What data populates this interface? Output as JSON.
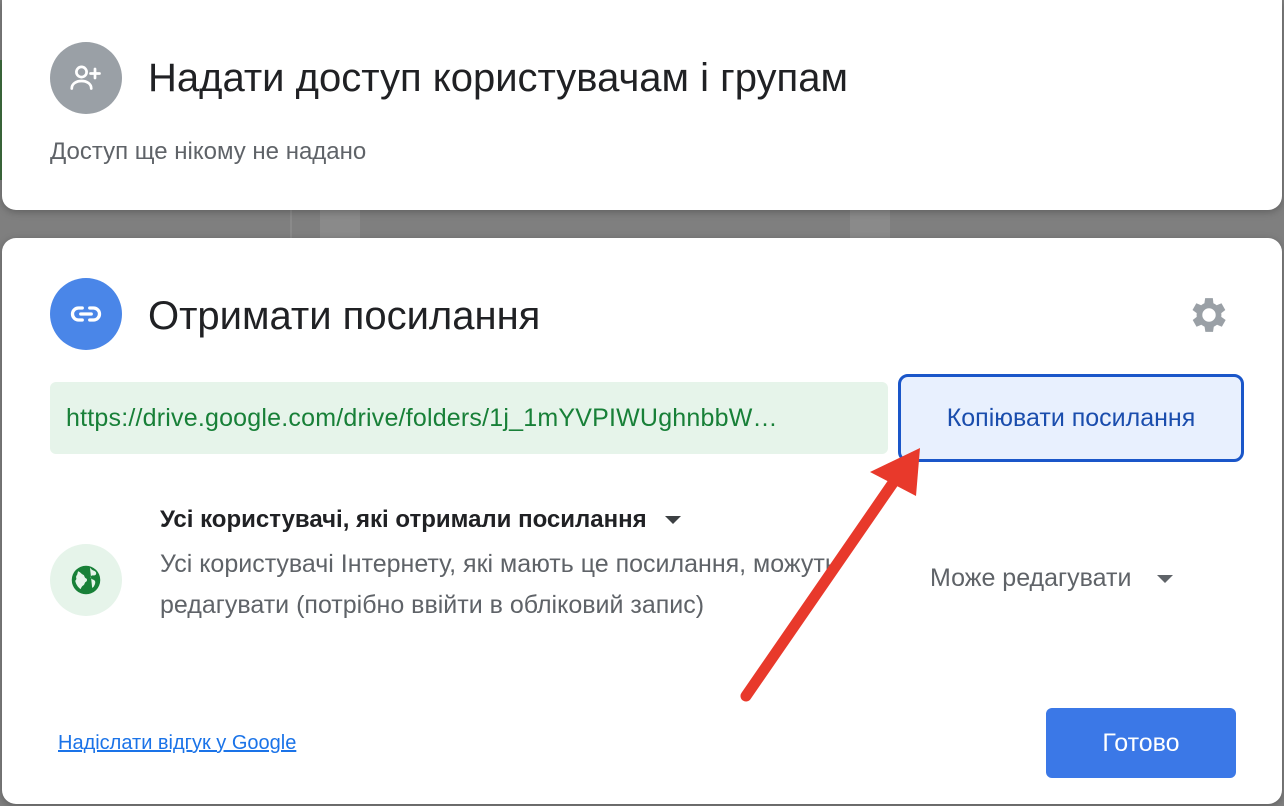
{
  "share_card": {
    "title": "Надати доступ користувачам і групам",
    "subtitle": "Доступ ще нікому не надано",
    "icon": "person-add-icon"
  },
  "link_card": {
    "title": "Отримати посилання",
    "icon": "link-icon",
    "settings_icon": "gear-icon",
    "link_url": "https://drive.google.com/drive/folders/1j_1mYVPIWUghnbbW…",
    "copy_button_label": "Копіювати посилання",
    "access": {
      "selected": "Усі користувачі, які отримали посилання",
      "description": "Усі користувачі Інтернету, які мають це посилання, можуть редагувати (потрібно ввійти в обліковий запис)",
      "icon": "globe-icon"
    },
    "role": {
      "selected": "Може редагувати"
    },
    "feedback_link": "Надіслати відгук у Google",
    "done_button_label": "Готово"
  },
  "annotation": {
    "type": "arrow",
    "color": "#e8392b",
    "points_to": "copy-button"
  },
  "colors": {
    "accent_blue": "#3b78e7",
    "link_green": "#188038",
    "link_field_bg": "#e6f4ea",
    "copy_button_border": "#1a56c9"
  }
}
